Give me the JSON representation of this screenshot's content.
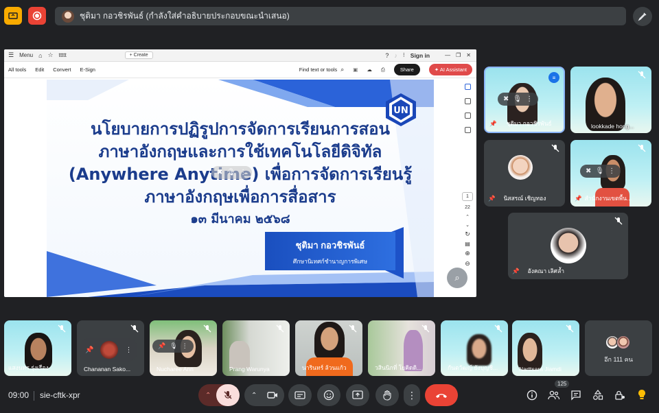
{
  "top_bar": {
    "presenter_text": "ชุติมา กอวชิรพันธ์ (กำลังใส่คำอธิบายประกอบขณะนำเสนอ)",
    "colors": {
      "yellow_btn": "#f9ab00",
      "red_btn": "#ea4335"
    }
  },
  "pdf": {
    "menu_label": "Menu",
    "tab_label": "ttttt",
    "create_label": "Create",
    "sign_in": "Sign in",
    "toolbar": {
      "all_tools": "All tools",
      "edit": "Edit",
      "convert": "Convert",
      "esign": "E-Sign",
      "find": "Find text or tools",
      "share": "Share",
      "ai_assistant": "AI Assistant"
    },
    "page_current": "1",
    "page_total": "22"
  },
  "slide": {
    "line1": "นโยบายการปฏิรูปการจัดการเรียนการสอน",
    "line2": "ภาษาอังกฤษและการใช้เทคโนโลยีดิจิทัล",
    "line3": "(Anywhere Anytime) เพื่อการจัดการเรียนรู้",
    "line4": "ภาษาอังกฤษเพื่อการสื่อสาร",
    "date": "๑๓ มีนาคม ๒๕๖๘",
    "presenter_name": "ชุติมา กอวชิรพันธ์",
    "presenter_title": "ศึกษานิเทศก์ชำนาญการพิเศษ"
  },
  "right_tiles": [
    {
      "name": "ชุติมา กอวชิรพันธ์"
    },
    {
      "name": "lookkade hong..."
    },
    {
      "name": "นิสสรณ์ เชิญทอง"
    },
    {
      "name": "สำนักงานเขตพื้น..."
    },
    {
      "name": "อังคณา เลิศล้ำ"
    }
  ],
  "bottom_tiles": [
    {
      "name": "แสงนทร รุ่งเรือง"
    },
    {
      "name": "Chananan Sako..."
    },
    {
      "name": "Nucharee Ann"
    },
    {
      "name": "Prang Warunya"
    },
    {
      "name": "นารินทร์ ล้วนแก้ว"
    },
    {
      "name": "วสินนิกที่ โยคิดดิ..."
    },
    {
      "name": "กันตวัฒญ์ ยังบุญชิ..."
    },
    {
      "name": "Narttsara Jiamdi"
    }
  ],
  "others_label": "อีก 111 คน",
  "bottom_bar": {
    "time": "09:00",
    "meeting_code": "sie-cftk-xpr",
    "participants_count": "125"
  }
}
